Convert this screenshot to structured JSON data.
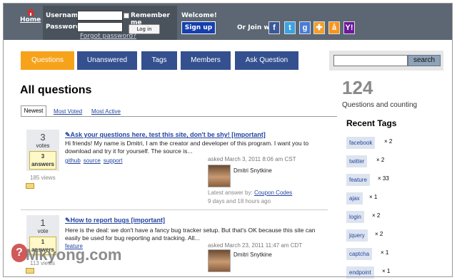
{
  "header": {
    "home_label": "Home",
    "username_label": "Username",
    "password_label": "Password",
    "remember_label": "Remember me",
    "login_button": "Log in",
    "forgot_link": "Forgot password?",
    "welcome": "Welcome!",
    "signup_button": "Sign up",
    "or_join": "Or Join with",
    "social": [
      {
        "name": "facebook-icon",
        "glyph": "f",
        "color": "#3b5998"
      },
      {
        "name": "twitter-icon",
        "glyph": "t",
        "color": "#3aa3e3"
      },
      {
        "name": "google-icon",
        "glyph": "g",
        "color": "#4a7bd6"
      },
      {
        "name": "aol-icon",
        "glyph": "✚",
        "color": "#f0a030"
      },
      {
        "name": "openid-icon",
        "glyph": "å",
        "color": "#f7941d"
      },
      {
        "name": "yahoo-icon",
        "glyph": "Y!",
        "color": "#6b1a9a"
      }
    ]
  },
  "nav": {
    "tabs": [
      {
        "label": "Questions",
        "active": true
      },
      {
        "label": "Unanswered",
        "active": false
      },
      {
        "label": "Tags",
        "active": false
      },
      {
        "label": "Members",
        "active": false
      },
      {
        "label": "Ask Question",
        "active": false
      }
    ],
    "search_button": "search"
  },
  "main": {
    "title": "All questions",
    "subtabs": [
      "Newest",
      "Most Voted",
      "Most Active"
    ],
    "questions": [
      {
        "votes": "3",
        "votes_label": "votes",
        "answers": "3",
        "answers_label": "answers",
        "views": "185 views",
        "title": "Ask your questions here, test this site, don't be shy! [important]",
        "excerpt": "Hi friends! My name is Dmitri, I am the creator and developer of this program.  I want you to download and try it for yourself. The source is...",
        "tags": [
          "github",
          "source",
          "support"
        ],
        "asked": "asked March 3, 2011 8:06 am CST",
        "author": "Dmitri Snytkine",
        "latest_prefix": "Latest answer by:",
        "latest_author": "Coupon Codes",
        "latest_time": "9 days and 18 hours ago"
      },
      {
        "votes": "1",
        "votes_label": "vote",
        "answers": "1",
        "answers_label": "answers",
        "views": "113 views",
        "title": "How to report bugs [important]",
        "excerpt": "Here is the deal: we don't have a fancy bug tracker setup. But that's OK because this site can easily be used for bug reporting and tracking. All...",
        "tags": [
          "feature"
        ],
        "asked": "asked March 23, 2011 11:47 am CDT",
        "author": "Dmitri Snytkine"
      }
    ]
  },
  "sidebar": {
    "count": "124",
    "count_label": "Questions and counting",
    "recent_tags_title": "Recent Tags",
    "tags": [
      {
        "name": "facebook",
        "count": "× 2"
      },
      {
        "name": "twitter",
        "count": "× 2"
      },
      {
        "name": "feature",
        "count": "× 33"
      },
      {
        "name": "ajax",
        "count": "× 1"
      },
      {
        "name": "login",
        "count": "× 2"
      },
      {
        "name": "jquery",
        "count": "× 2"
      },
      {
        "name": "captcha",
        "count": "× 1"
      },
      {
        "name": "endpoint",
        "count": "× 1"
      }
    ]
  },
  "watermark": "Mkyong.com",
  "colors": {
    "header_bg": "#5c6773",
    "tab_active": "#f7a21b",
    "tab_inactive": "#34508f",
    "link": "#2445a0"
  }
}
